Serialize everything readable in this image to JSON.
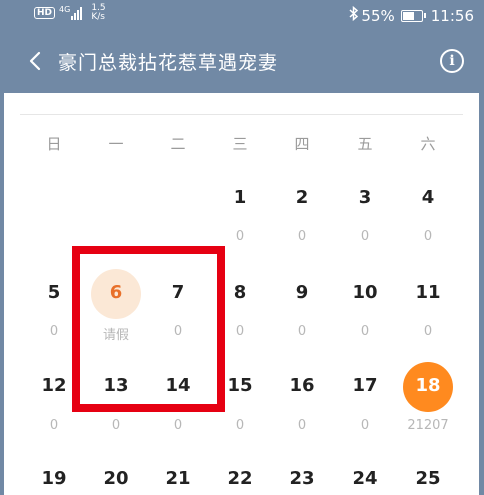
{
  "status_bar": {
    "hd_badge": "HD",
    "net_type": "4G",
    "speed_value": "1.5",
    "speed_unit": "K/s",
    "battery": "55%",
    "time": "11:56"
  },
  "header": {
    "title": "豪门总裁拈花惹草遇宠妻"
  },
  "calendar": {
    "weekdays": [
      "日",
      "一",
      "二",
      "三",
      "四",
      "五",
      "六"
    ],
    "weeks": [
      [
        {
          "day": "",
          "sub": ""
        },
        {
          "day": "",
          "sub": ""
        },
        {
          "day": "",
          "sub": ""
        },
        {
          "day": "1",
          "sub": "0"
        },
        {
          "day": "2",
          "sub": "0"
        },
        {
          "day": "3",
          "sub": "0"
        },
        {
          "day": "4",
          "sub": "0"
        }
      ],
      [
        {
          "day": "5",
          "sub": "0"
        },
        {
          "day": "6",
          "sub": "请假",
          "today": true
        },
        {
          "day": "7",
          "sub": "0"
        },
        {
          "day": "8",
          "sub": "0"
        },
        {
          "day": "9",
          "sub": "0"
        },
        {
          "day": "10",
          "sub": "0"
        },
        {
          "day": "11",
          "sub": "0"
        }
      ],
      [
        {
          "day": "12",
          "sub": "0"
        },
        {
          "day": "13",
          "sub": "0"
        },
        {
          "day": "14",
          "sub": "0"
        },
        {
          "day": "15",
          "sub": "0"
        },
        {
          "day": "16",
          "sub": "0"
        },
        {
          "day": "17",
          "sub": "0"
        },
        {
          "day": "18",
          "sub": "21207",
          "selected": true
        }
      ],
      [
        {
          "day": "19",
          "sub": ""
        },
        {
          "day": "20",
          "sub": ""
        },
        {
          "day": "21",
          "sub": ""
        },
        {
          "day": "22",
          "sub": ""
        },
        {
          "day": "23",
          "sub": ""
        },
        {
          "day": "24",
          "sub": ""
        },
        {
          "day": "25",
          "sub": ""
        }
      ]
    ]
  },
  "colors": {
    "header_bg": "#7189a5",
    "today_bg": "#fbe8d6",
    "today_text": "#e8702a",
    "selected_bg": "#ff8a1f",
    "highlight_border": "#e60012"
  },
  "icons": {
    "back": "chevron-left-icon",
    "info": "info-circle-icon",
    "bluetooth": "bluetooth-icon",
    "battery": "battery-icon",
    "signal": "signal-icon"
  }
}
